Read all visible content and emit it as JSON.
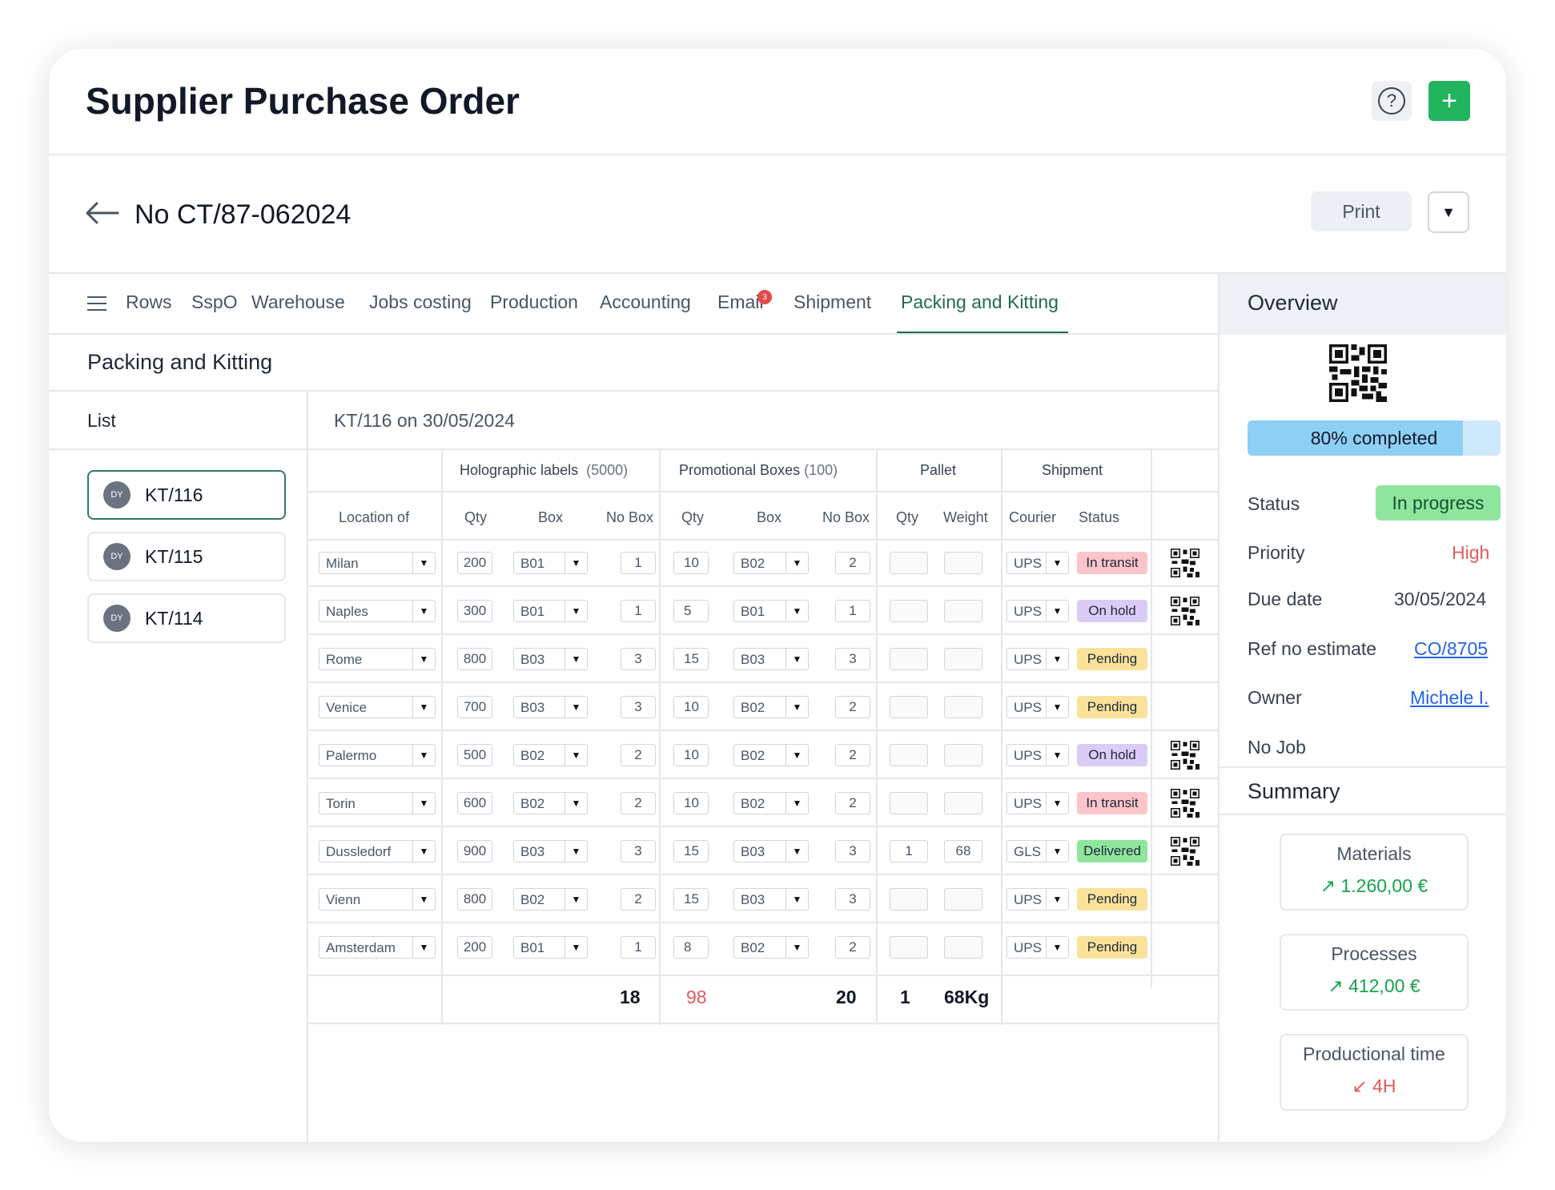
{
  "header": {
    "title": "Supplier Purchase Order",
    "help_icon": "?",
    "add_icon": "+"
  },
  "order": {
    "number": "No CT/87-062024",
    "print_label": "Print",
    "dropdown_icon": "▼"
  },
  "tabs": [
    {
      "label": "Rows"
    },
    {
      "label": "SspO"
    },
    {
      "label": "Warehouse"
    },
    {
      "label": "Jobs costing"
    },
    {
      "label": "Production"
    },
    {
      "label": "Accounting"
    },
    {
      "label": "Email",
      "badge": "3"
    },
    {
      "label": "Shipment"
    },
    {
      "label": "Packing and Kitting",
      "active": true
    }
  ],
  "section": {
    "title": "Packing and Kitting",
    "list_label": "List",
    "detail_title": "KT/116 on 30/05/2024"
  },
  "list": [
    {
      "avatar": "DY",
      "label": "KT/116",
      "active": true
    },
    {
      "avatar": "DY",
      "label": "KT/115"
    },
    {
      "avatar": "DY",
      "label": "KT/114"
    }
  ],
  "table": {
    "groups": {
      "holo": "Holographic labels",
      "holo_count": "(5000)",
      "promo": "Promotional Boxes",
      "promo_count": "(100)",
      "pallet": "Pallet",
      "shipment": "Shipment"
    },
    "columns": {
      "location": "Location of",
      "qty": "Qty",
      "box": "Box",
      "nobox": "No Box",
      "weight": "Weight",
      "courier": "Courier",
      "status": "Status"
    },
    "rows": [
      {
        "location": "Milan",
        "h_qty": "200",
        "h_box": "B01",
        "h_nobox": "1",
        "p_qty": "10",
        "p_box": "B02",
        "p_nobox": "2",
        "pl_qty": "",
        "pl_weight": "",
        "courier": "UPS",
        "status": "In transit",
        "status_color": "#fbc5c9",
        "qr": true
      },
      {
        "location": "Naples",
        "h_qty": "300",
        "h_box": "B01",
        "h_nobox": "1",
        "p_qty": "5",
        "p_box": "B01",
        "p_nobox": "1",
        "pl_qty": "",
        "pl_weight": "",
        "courier": "UPS",
        "status": "On hold",
        "status_color": "#d9ccf7",
        "qr": true
      },
      {
        "location": "Rome",
        "h_qty": "800",
        "h_box": "B03",
        "h_nobox": "3",
        "p_qty": "15",
        "p_box": "B03",
        "p_nobox": "3",
        "pl_qty": "",
        "pl_weight": "",
        "courier": "UPS",
        "status": "Pending",
        "status_color": "#fbe29a",
        "qr": false
      },
      {
        "location": "Venice",
        "h_qty": "700",
        "h_box": "B03",
        "h_nobox": "3",
        "p_qty": "10",
        "p_box": "B02",
        "p_nobox": "2",
        "pl_qty": "",
        "pl_weight": "",
        "courier": "UPS",
        "status": "Pending",
        "status_color": "#fbe29a",
        "qr": false
      },
      {
        "location": "Palermo",
        "h_qty": "500",
        "h_box": "B02",
        "h_nobox": "2",
        "p_qty": "10",
        "p_box": "B02",
        "p_nobox": "2",
        "pl_qty": "",
        "pl_weight": "",
        "courier": "UPS",
        "status": "On hold",
        "status_color": "#d9ccf7",
        "qr": true
      },
      {
        "location": "Torin",
        "h_qty": "600",
        "h_box": "B02",
        "h_nobox": "2",
        "p_qty": "10",
        "p_box": "B02",
        "p_nobox": "2",
        "pl_qty": "",
        "pl_weight": "",
        "courier": "UPS",
        "status": "In transit",
        "status_color": "#fbc5c9",
        "qr": true
      },
      {
        "location": "Dussledorf",
        "h_qty": "900",
        "h_box": "B03",
        "h_nobox": "3",
        "p_qty": "15",
        "p_box": "B03",
        "p_nobox": "3",
        "pl_qty": "1",
        "pl_weight": "68",
        "courier": "GLS",
        "status": "Delivered",
        "status_color": "#8fe59d",
        "qr": true
      },
      {
        "location": "Vienn",
        "h_qty": "800",
        "h_box": "B02",
        "h_nobox": "2",
        "p_qty": "15",
        "p_box": "B03",
        "p_nobox": "3",
        "pl_qty": "",
        "pl_weight": "",
        "courier": "UPS",
        "status": "Pending",
        "status_color": "#fbe29a",
        "qr": false
      },
      {
        "location": "Amsterdam",
        "h_qty": "200",
        "h_box": "B01",
        "h_nobox": "1",
        "p_qty": "8",
        "p_box": "B02",
        "p_nobox": "2",
        "pl_qty": "",
        "pl_weight": "",
        "courier": "UPS",
        "status": "Pending",
        "status_color": "#fbe29a",
        "qr": false
      }
    ],
    "totals": {
      "h_nobox": "18",
      "p_qty": "98",
      "p_nobox": "20",
      "pl_qty": "1",
      "pl_weight": "68Kg"
    }
  },
  "overview": {
    "title": "Overview",
    "progress_label": "80% completed",
    "progress_value": 0.85,
    "fields": {
      "status_label": "Status",
      "status_value": "In progress",
      "priority_label": "Priority",
      "priority_value": "High",
      "due_label": "Due date",
      "due_value": "30/05/2024",
      "ref_label": "Ref no estimate",
      "ref_value": "CO/8705",
      "owner_label": "Owner",
      "owner_value": "Michele I.",
      "nojob_label": "No Job"
    }
  },
  "summary": {
    "title": "Summary",
    "cards": [
      {
        "label": "Materials",
        "value": "1.260,00 €",
        "trend": "up"
      },
      {
        "label": "Processes",
        "value": "412,00 €",
        "trend": "up"
      },
      {
        "label": "Productional time",
        "value": "4H",
        "trend": "down"
      }
    ]
  }
}
